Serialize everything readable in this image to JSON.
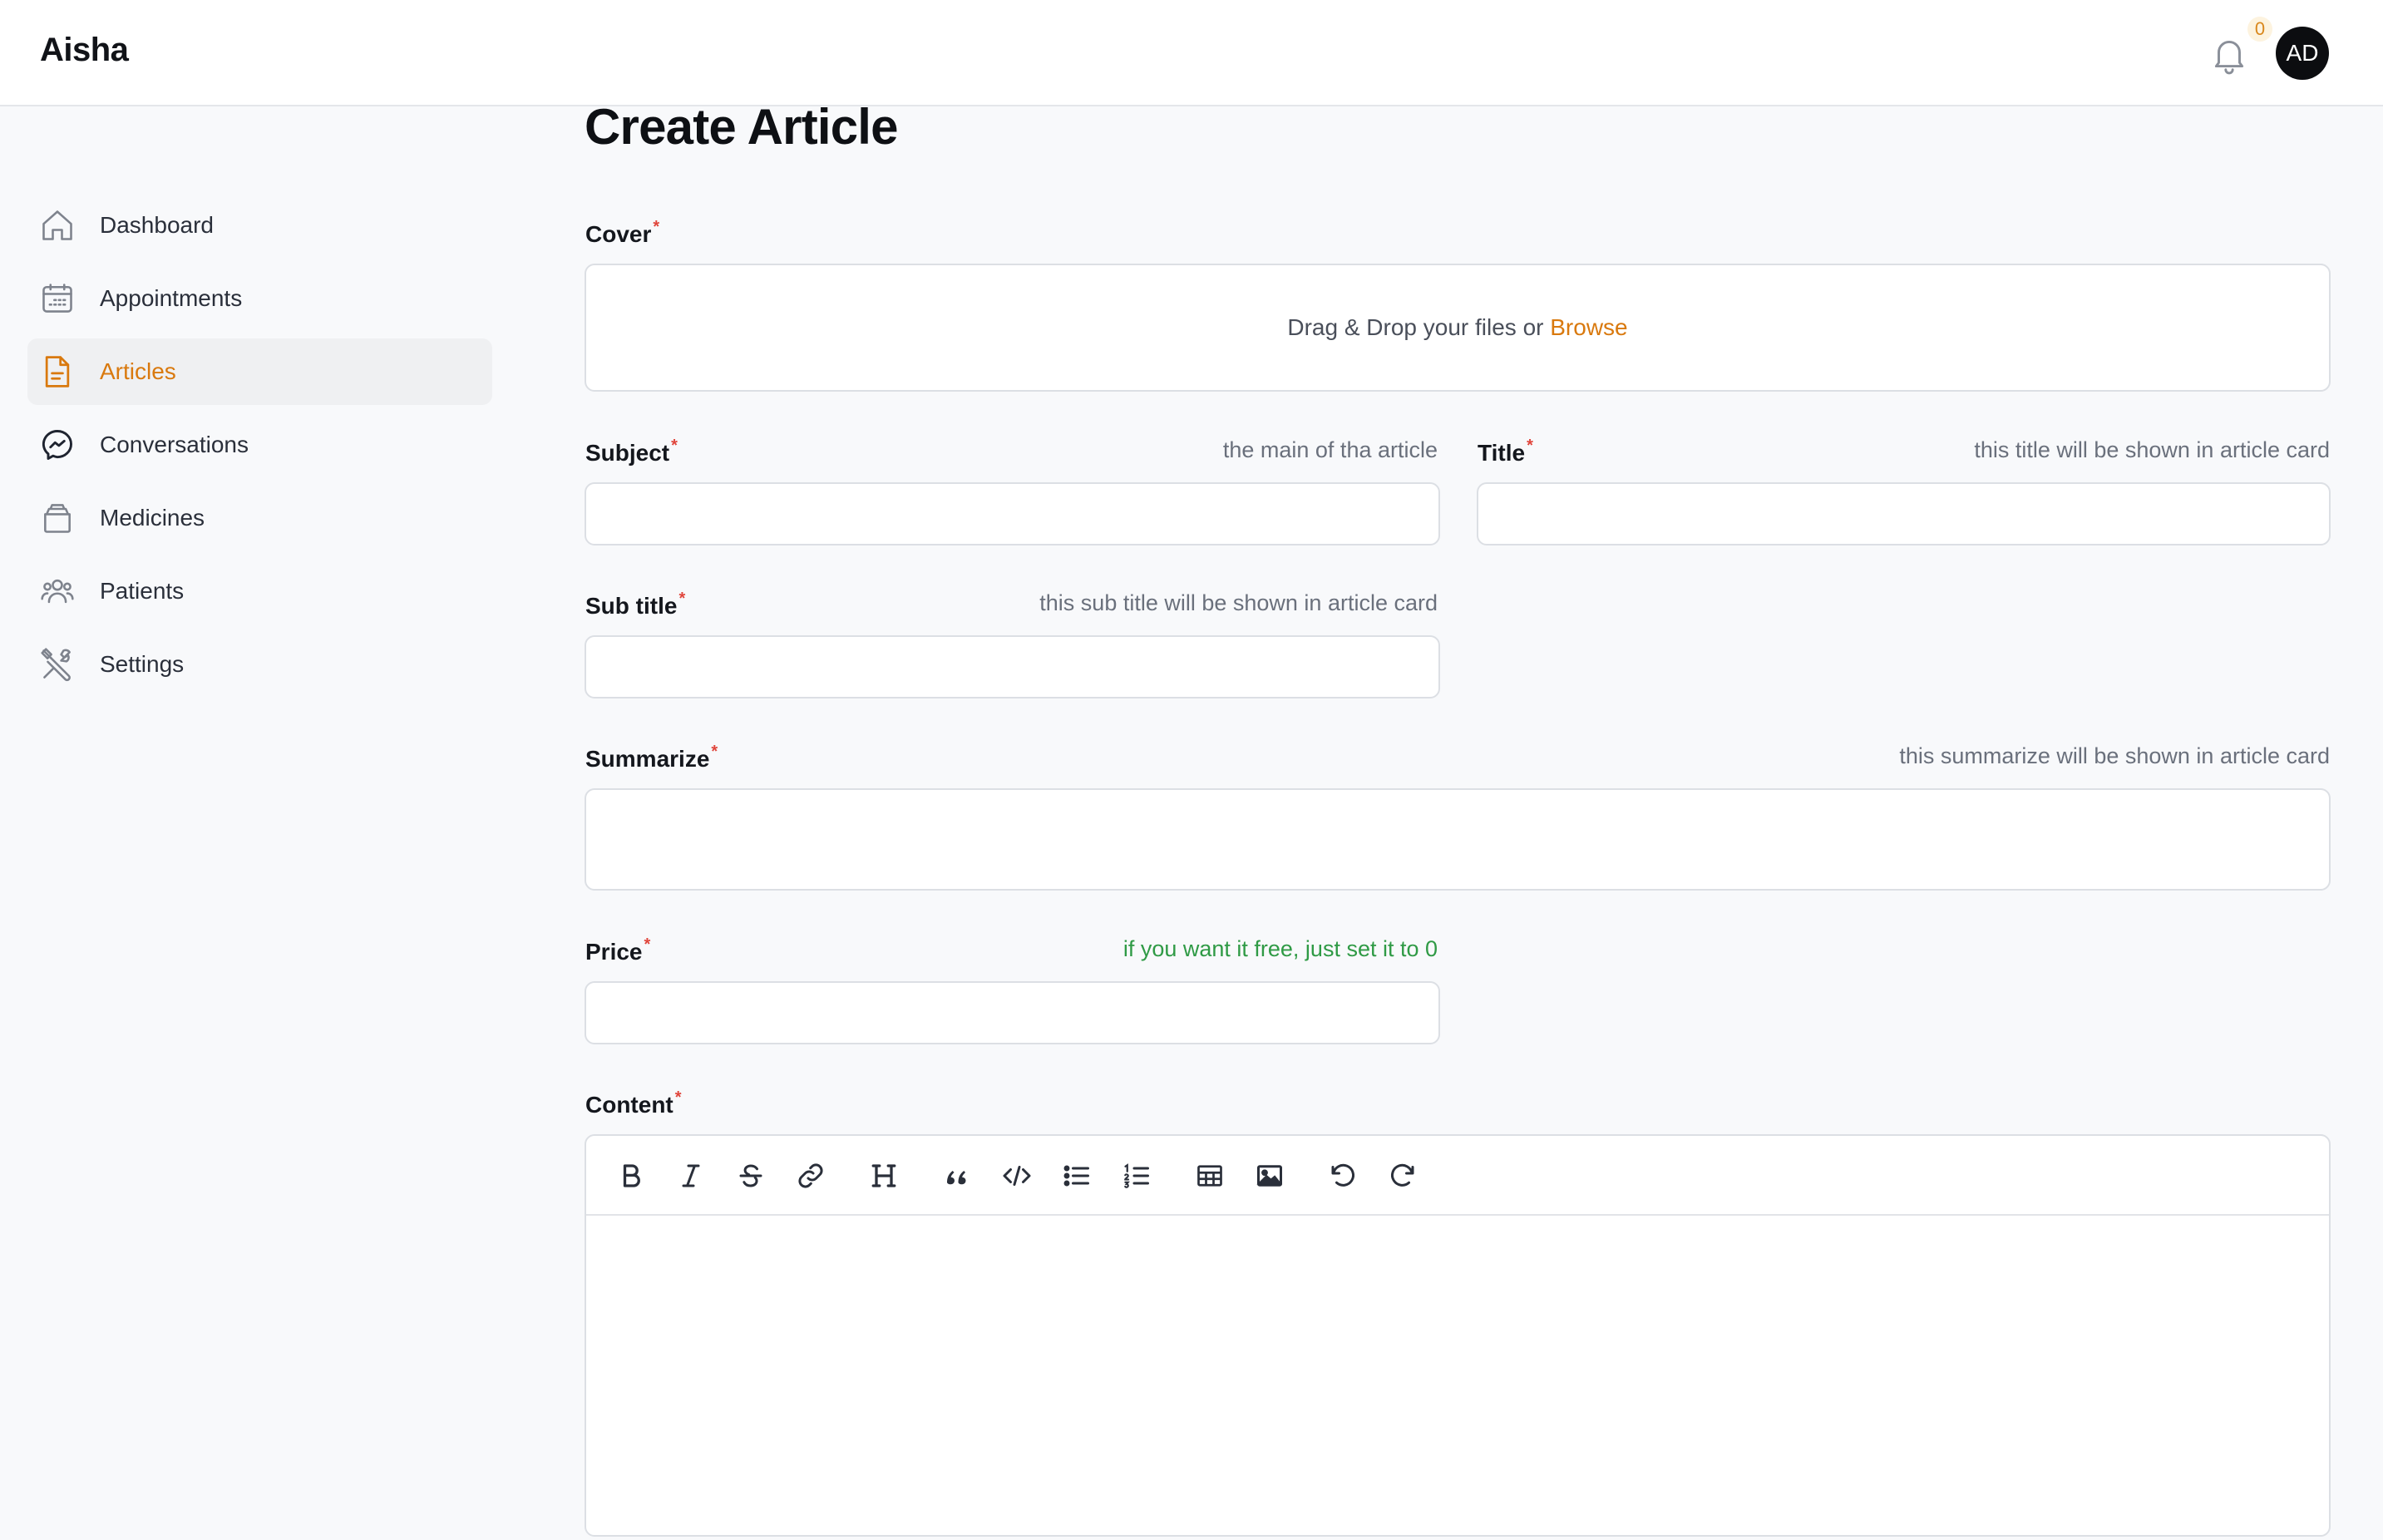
{
  "app": {
    "brand": "Aisha",
    "notification_count": "0",
    "avatar_initials": "AD",
    "accent_color": "#d9790e"
  },
  "sidebar": {
    "items": [
      {
        "label": "Dashboard",
        "icon": "home-icon",
        "active": false
      },
      {
        "label": "Appointments",
        "icon": "calendar-icon",
        "active": false
      },
      {
        "label": "Articles",
        "icon": "document-icon",
        "active": true
      },
      {
        "label": "Conversations",
        "icon": "messenger-icon",
        "active": false
      },
      {
        "label": "Medicines",
        "icon": "medicine-box-icon",
        "active": false
      },
      {
        "label": "Patients",
        "icon": "users-icon",
        "active": false
      },
      {
        "label": "Settings",
        "icon": "tools-icon",
        "active": false
      }
    ]
  },
  "page": {
    "title": "Create Article"
  },
  "form": {
    "required_mark": "*",
    "cover": {
      "label": "Cover",
      "drop_text": "Drag & Drop your files or",
      "browse": "Browse"
    },
    "subject": {
      "label": "Subject",
      "hint": "the main of tha article",
      "value": ""
    },
    "title": {
      "label": "Title",
      "hint": "this title will be shown in article card",
      "value": ""
    },
    "subtitle": {
      "label": "Sub title",
      "hint": "this sub title will be shown in article card",
      "value": ""
    },
    "summarize": {
      "label": "Summarize",
      "hint": "this summarize will be shown in article card",
      "value": ""
    },
    "price": {
      "label": "Price",
      "hint": "if you want it free, just set it to 0",
      "value": ""
    },
    "content": {
      "label": "Content",
      "toolbar": [
        "bold-icon",
        "italic-icon",
        "strikethrough-icon",
        "link-icon",
        "heading-icon",
        "quote-icon",
        "code-icon",
        "bullet-list-icon",
        "numbered-list-icon",
        "table-icon",
        "image-icon",
        "undo-icon",
        "redo-icon"
      ]
    }
  }
}
